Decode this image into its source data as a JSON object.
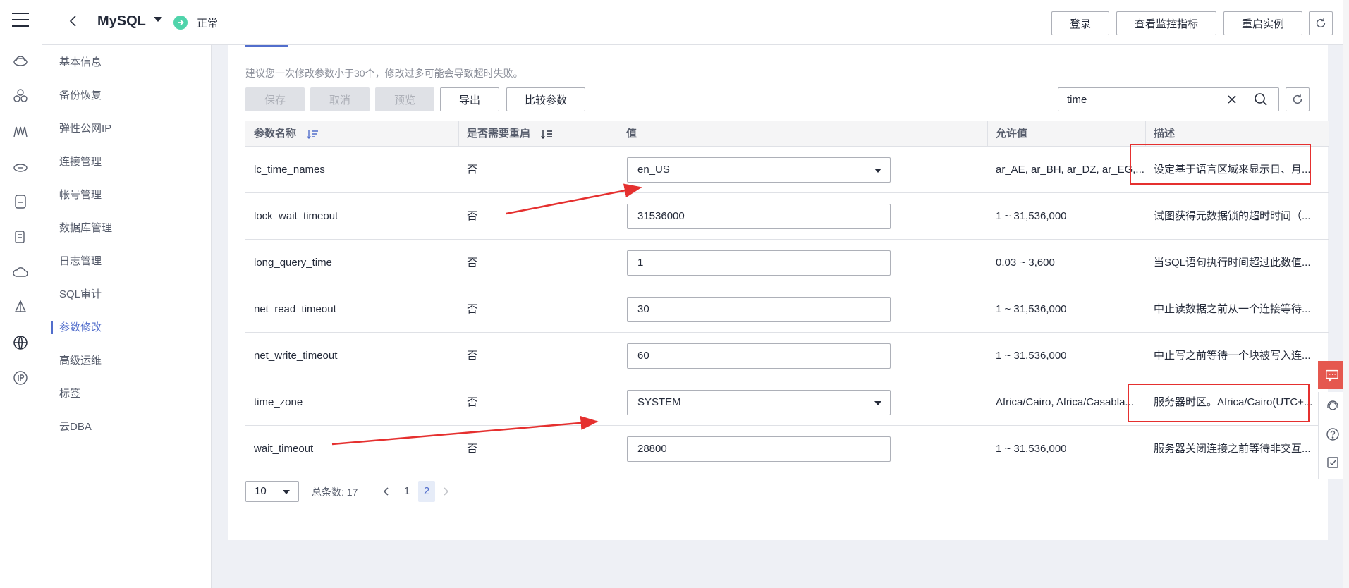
{
  "header": {
    "title": "MySQL",
    "status": "正常",
    "buttons": {
      "login": "登录",
      "monitor": "查看监控指标",
      "restart": "重启实例"
    }
  },
  "sidebar": {
    "items": [
      {
        "label": "基本信息"
      },
      {
        "label": "备份恢复"
      },
      {
        "label": "弹性公网IP"
      },
      {
        "label": "连接管理"
      },
      {
        "label": "帐号管理"
      },
      {
        "label": "数据库管理"
      },
      {
        "label": "日志管理"
      },
      {
        "label": "SQL审计"
      },
      {
        "label": "参数修改",
        "active": true
      },
      {
        "label": "高级运维"
      },
      {
        "label": "标签"
      },
      {
        "label": "云DBA"
      }
    ]
  },
  "main": {
    "hint": "建议您一次修改参数小于30个，修改过多可能会导致超时失败。",
    "toolbar": {
      "save": "保存",
      "cancel": "取消",
      "preview": "预览",
      "export": "导出",
      "compare": "比较参数"
    },
    "search": {
      "value": "time"
    },
    "columns": [
      "参数名称",
      "是否需要重启",
      "值",
      "允许值",
      "描述"
    ],
    "rows": [
      {
        "name": "lc_time_names",
        "restart": "否",
        "value": "en_US",
        "type": "select",
        "allowed": "ar_AE, ar_BH, ar_DZ, ar_EG,...",
        "desc": "设定基于语言区域来显示日、月..."
      },
      {
        "name": "lock_wait_timeout",
        "restart": "否",
        "value": "31536000",
        "type": "input",
        "allowed": "1 ~ 31,536,000",
        "desc": "试图获得元数据锁的超时时间（..."
      },
      {
        "name": "long_query_time",
        "restart": "否",
        "value": "1",
        "type": "input",
        "allowed": "0.03 ~ 3,600",
        "desc": "当SQL语句执行时间超过此数值..."
      },
      {
        "name": "net_read_timeout",
        "restart": "否",
        "value": "30",
        "type": "input",
        "allowed": "1 ~ 31,536,000",
        "desc": "中止读数据之前从一个连接等待..."
      },
      {
        "name": "net_write_timeout",
        "restart": "否",
        "value": "60",
        "type": "input",
        "allowed": "1 ~ 31,536,000",
        "desc": "中止写之前等待一个块被写入连..."
      },
      {
        "name": "time_zone",
        "restart": "否",
        "value": "SYSTEM",
        "type": "select",
        "allowed": "Africa/Cairo, Africa/Casabla...",
        "desc": "服务器时区。Africa/Cairo(UTC+..."
      },
      {
        "name": "wait_timeout",
        "restart": "否",
        "value": "28800",
        "type": "input",
        "allowed": "1 ~ 31,536,000",
        "desc": "服务器关闭连接之前等待非交互..."
      }
    ],
    "pagination": {
      "page_size": "10",
      "total": "总条数: 17",
      "pages": [
        "1",
        "2"
      ],
      "current": "2"
    }
  },
  "colors": {
    "accent": "#526ecc",
    "annotation": "#e5302f",
    "status_ok": "#50d4ab",
    "chat": "#e5584f"
  }
}
